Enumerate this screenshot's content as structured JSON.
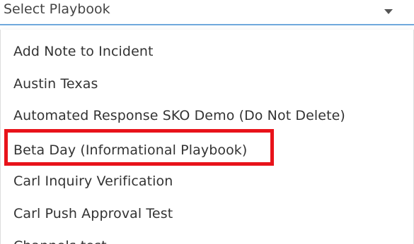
{
  "select": {
    "label": "Select Playbook"
  },
  "options": [
    "Add Note to Incident",
    "Austin Texas",
    "Automated Response SKO Demo (Do Not Delete)",
    "Beta Day (Informational Playbook)",
    "Carl Inquiry Verification",
    "Carl Push Approval Test",
    "Channels test"
  ],
  "highlighted_option": "Beta Day (Informational Playbook)",
  "colors": {
    "accent_border": "#6fa8dc",
    "highlight": "#e8131a",
    "text": "#333333"
  }
}
